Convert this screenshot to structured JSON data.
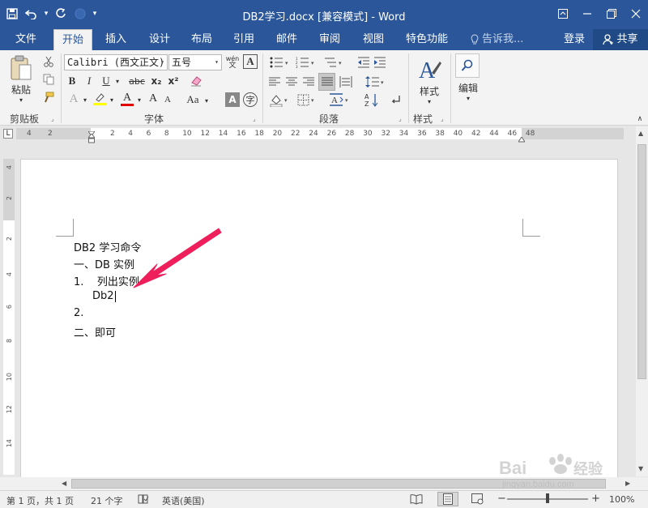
{
  "titlebar": {
    "title": "DB2学习.docx [兼容模式] - Word",
    "icons": [
      "save-icon",
      "undo-icon",
      "redo-icon",
      "touch-mode-icon",
      "customize-qat-icon"
    ],
    "window_buttons": [
      "ribbon-display-icon",
      "minimize-icon",
      "restore-icon",
      "close-icon"
    ]
  },
  "tabs": [
    {
      "label": "文件"
    },
    {
      "label": "开始"
    },
    {
      "label": "插入"
    },
    {
      "label": "设计"
    },
    {
      "label": "布局"
    },
    {
      "label": "引用"
    },
    {
      "label": "邮件"
    },
    {
      "label": "审阅"
    },
    {
      "label": "视图"
    },
    {
      "label": "特色功能"
    }
  ],
  "tellme": "告诉我...",
  "login": "登录",
  "share": "共享",
  "ribbon": {
    "clipboard": {
      "paste_label": "粘贴",
      "group_label": "剪贴板"
    },
    "font": {
      "font_name": "Calibri (西文正文)",
      "font_size": "五号",
      "group_label": "字体",
      "bold": "B",
      "italic": "I",
      "underline": "U",
      "strikethrough": "abc",
      "subscript": "x₂",
      "superscript": "x²",
      "font_color": "A",
      "grow": "A",
      "shrink": "A",
      "case": "Aa",
      "phonetic": "wén",
      "enclose": "字",
      "colors": {
        "highlight": "#ffff00",
        "font_color": "#e00000"
      }
    },
    "paragraph": {
      "group_label": "段落"
    },
    "styles": {
      "label": "样式",
      "group_label": "样式"
    },
    "editing": {
      "label": "编辑"
    }
  },
  "ruler": {
    "left_numbers": [
      "4",
      "2"
    ],
    "numbers": [
      "2",
      "4",
      "6",
      "8",
      "10",
      "12",
      "14",
      "16",
      "18",
      "20",
      "22",
      "24",
      "26",
      "28",
      "30",
      "32",
      "34",
      "36",
      "38",
      "40",
      "42",
      "44",
      "46",
      "48"
    ],
    "tab_selector": "L"
  },
  "vruler": {
    "numbers": [
      "4",
      "2",
      "2",
      "4",
      "6",
      "8",
      "10",
      "12",
      "14"
    ]
  },
  "document": {
    "lines": [
      "DB2 学习命令",
      "一、DB 实例",
      "1.    列出实例",
      "Db2",
      "2.",
      "二、即可"
    ]
  },
  "statusbar": {
    "page": "第 1 页，共 1 页",
    "words": "21 个字",
    "language": "英语(美国)",
    "zoom": "100%",
    "zoom_percent": 100
  },
  "watermark": {
    "brand": "Bai du 经验",
    "url": "jingyan.baidu.com"
  },
  "colors": {
    "accent": "#2b579a",
    "annotation_arrow": "#ee1f5a"
  }
}
